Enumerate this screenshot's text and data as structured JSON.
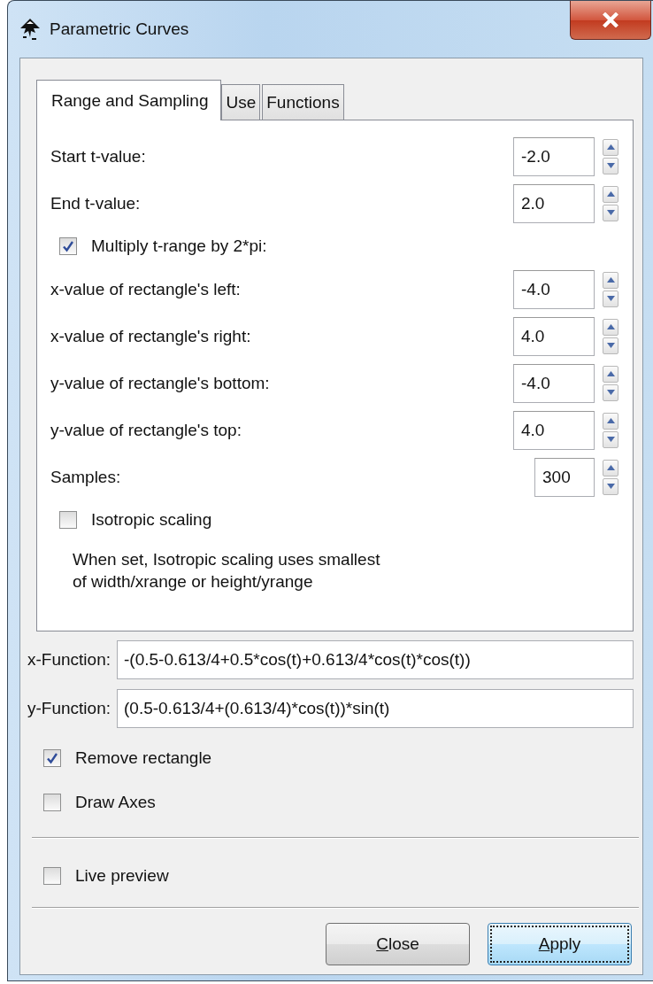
{
  "window": {
    "title": "Parametric Curves"
  },
  "tabs": [
    {
      "label": "Range and Sampling",
      "selected": true
    },
    {
      "label": "Use",
      "selected": false
    },
    {
      "label": "Functions",
      "selected": false
    }
  ],
  "range_panel": {
    "rows": [
      {
        "kind": "spin",
        "label": "Start t-value:",
        "value": "-2.0"
      },
      {
        "kind": "spin",
        "label": "End t-value:",
        "value": "2.0"
      },
      {
        "kind": "check",
        "label": "Multiply t-range by 2*pi:",
        "checked": true
      },
      {
        "kind": "spin",
        "label": "x-value of rectangle's left:",
        "value": "-4.0"
      },
      {
        "kind": "spin",
        "label": "x-value of rectangle's right:",
        "value": "4.0"
      },
      {
        "kind": "spin",
        "label": "y-value of rectangle's bottom:",
        "value": "-4.0"
      },
      {
        "kind": "spin",
        "label": "y-value of rectangle's top:",
        "value": "4.0"
      },
      {
        "kind": "intspin",
        "label": "Samples:",
        "value": "300"
      },
      {
        "kind": "check",
        "label": "Isotropic scaling",
        "checked": false
      },
      {
        "kind": "note",
        "text": "When set, Isotropic scaling uses smallest\nof width/xrange or height/yrange"
      }
    ]
  },
  "functions": [
    {
      "label": "x-Function:",
      "value": "-(0.5-0.613/4+0.5*cos(t)+0.613/4*cos(t)*cos(t))"
    },
    {
      "label": "y-Function:",
      "value": "(0.5-0.613/4+(0.613/4)*cos(t))*sin(t)"
    }
  ],
  "options": [
    {
      "label": "Remove rectangle",
      "checked": true
    },
    {
      "label": "Draw Axes",
      "checked": false
    }
  ],
  "live_preview": {
    "label": "Live preview",
    "checked": false
  },
  "buttons": [
    {
      "label": "Close",
      "focused": false,
      "mnemonic": true
    },
    {
      "label": "Apply",
      "focused": true,
      "mnemonic": true
    }
  ]
}
